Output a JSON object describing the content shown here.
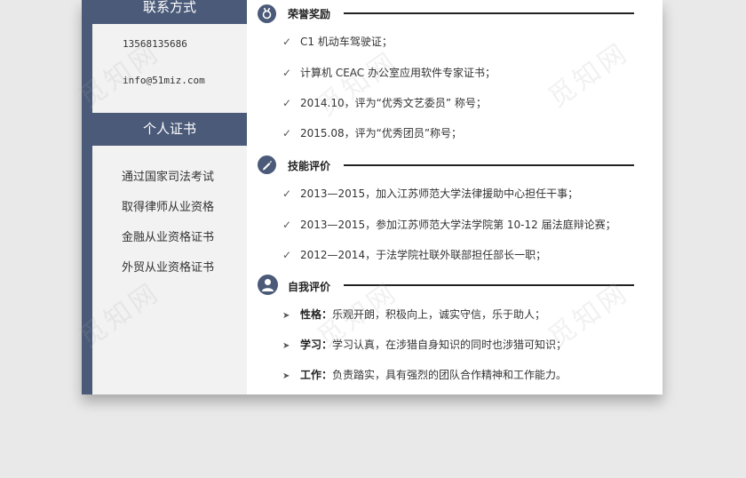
{
  "sidebar": {
    "contact_header": "联系方式",
    "phone": "13568135686",
    "email": "info@51miz.com",
    "cert_header": "个人证书",
    "certificates": [
      "通过国家司法考试",
      "取得律师从业资格",
      "金融从业资格证书",
      "外贸从业资格证书"
    ]
  },
  "sections": {
    "honors": {
      "title": "荣誉奖励",
      "icon": "medal-icon",
      "items": [
        "C1 机动车驾驶证；",
        "计算机 CEAC 办公室应用软件专家证书；",
        "2014.10，评为“优秀文艺委员”  称号；",
        "2015.08，评为“优秀团员”称号；"
      ]
    },
    "skills": {
      "title": "技能评价",
      "icon": "pen-icon",
      "items": [
        "2013—2015，加入江苏师范大学法律援助中心担任干事；",
        "2013—2015，参加江苏师范大学法学院第 10-12 届法庭辩论赛；",
        "2012—2014，于法学院社联外联部担任部长一职；"
      ]
    },
    "self": {
      "title": "自我评价",
      "icon": "person-icon",
      "items": [
        {
          "label": "性格：",
          "text": "乐观开朗，积极向上，诚实守信，乐于助人；"
        },
        {
          "label": "学习：",
          "text": "学习认真，在涉猎自身知识的同时也涉猎可知识；"
        },
        {
          "label": "工作：",
          "text": "负责踏实，具有强烈的团队合作精神和工作能力。"
        }
      ]
    }
  },
  "watermark": "觅知网",
  "bullets": {
    "check": "✓",
    "arrow": "➤"
  },
  "colors": {
    "accent": "#4a5a78",
    "sidebar_bg": "#f2f2f2",
    "page_bg": "#e9e9e9"
  }
}
